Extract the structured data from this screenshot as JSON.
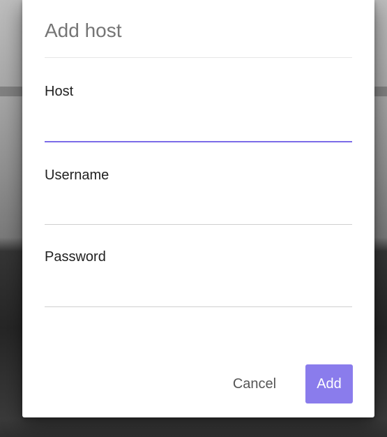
{
  "dialog": {
    "title": "Add host"
  },
  "fields": {
    "host": {
      "label": "Host",
      "value": "",
      "placeholder": ""
    },
    "username": {
      "label": "Username",
      "value": "",
      "placeholder": ""
    },
    "password": {
      "label": "Password",
      "value": "",
      "placeholder": ""
    }
  },
  "actions": {
    "cancel_label": "Cancel",
    "add_label": "Add"
  },
  "colors": {
    "accent": "#7b6be8",
    "button_fill": "#8a7cec",
    "title_text": "#757575"
  }
}
